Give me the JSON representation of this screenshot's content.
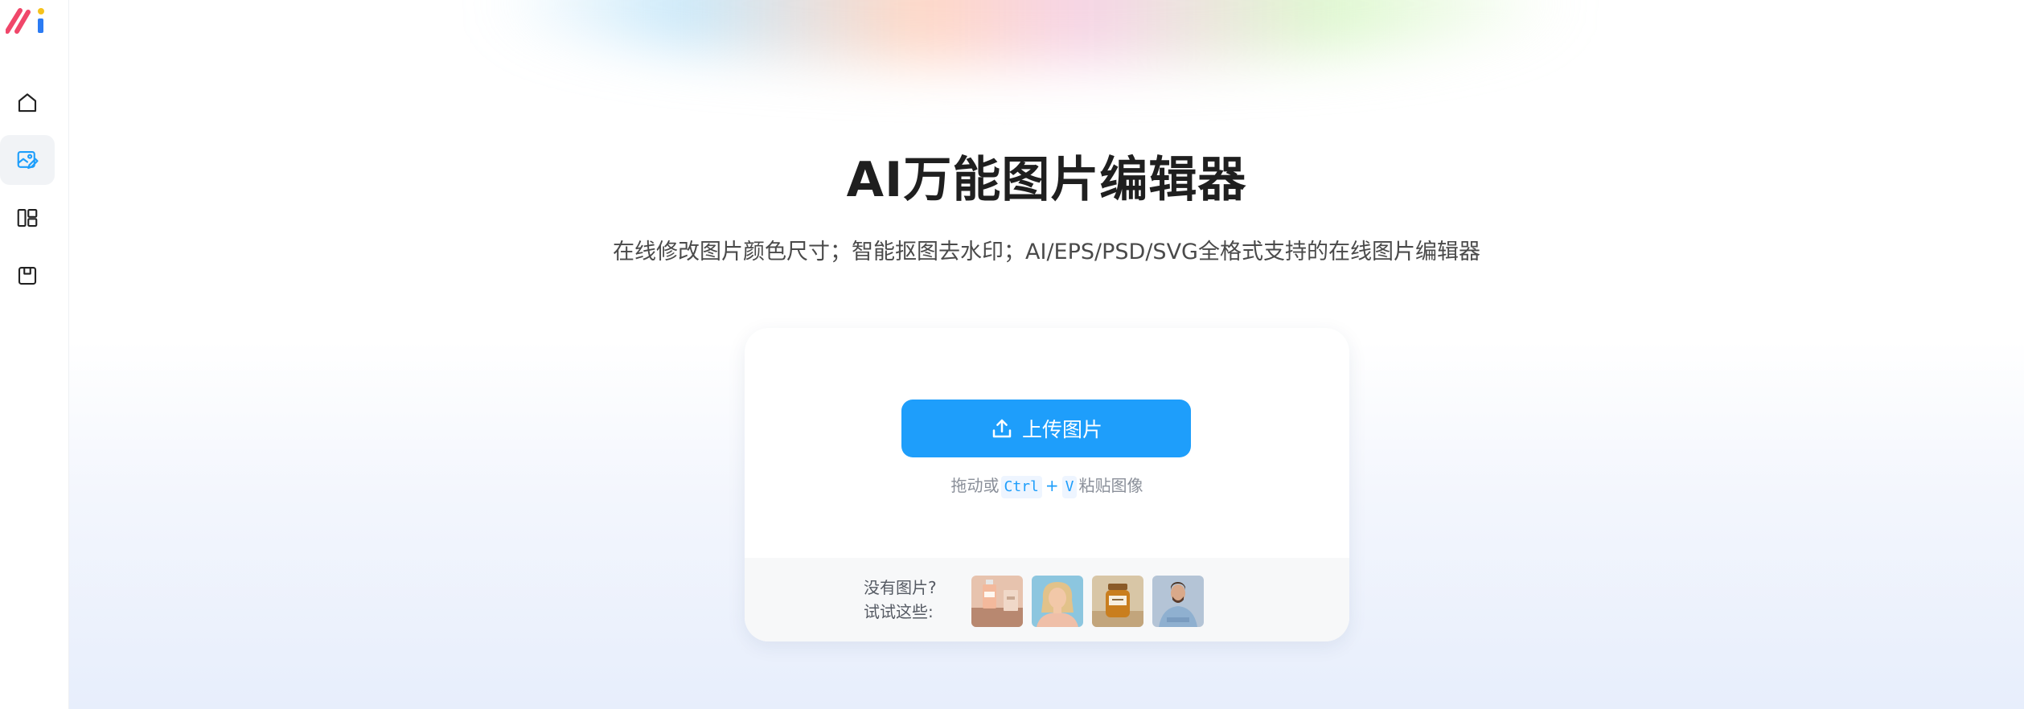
{
  "sidebar": {
    "items": [
      {
        "icon": "home-icon",
        "active": false
      },
      {
        "icon": "image-edit-icon",
        "active": true
      },
      {
        "icon": "layout-icon",
        "active": false
      },
      {
        "icon": "save-icon",
        "active": false
      }
    ]
  },
  "main": {
    "title": "AI万能图片编辑器",
    "subtitle": "在线修改图片颜色尺寸；智能抠图去水印；AI/EPS/PSD/SVG全格式支持的在线图片编辑器"
  },
  "upload": {
    "button_label": "上传图片",
    "hint_prefix": "拖动或",
    "key_ctrl": "Ctrl",
    "key_plus": "+",
    "key_v": "V",
    "hint_suffix": "粘贴图像"
  },
  "samples": {
    "label_line1": "没有图片?",
    "label_line2": "试试这些:",
    "items": [
      "perfume-bottle-thumbnail",
      "woman-portrait-thumbnail",
      "honey-jar-thumbnail",
      "man-portrait-thumbnail"
    ]
  },
  "colors": {
    "accent": "#1e9efb",
    "title": "#1f1f1f",
    "sidebar_active": "#f1f3f6"
  }
}
